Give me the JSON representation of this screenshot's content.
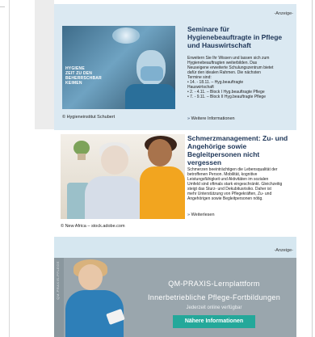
{
  "ad1": {
    "anzeige": "-Anzeige-",
    "image_overlay": [
      "HYGIENE",
      "ZEIT ZU DEN",
      "BEHERRSCHBAR",
      "KEIMEN"
    ],
    "credit": "© Hygieneinstitut Schubert",
    "title": "Seminare für Hygienebeauftragte in Pflege und Hauswirtschaft",
    "text_lines": [
      "Erweitern Sie Ihr Wissen und lassen sich zum",
      "Hygienebeauftragten weiterbilden. Das",
      "Neuseigene erweiterte Schulungszentrum bietet",
      "dafür den idealen Rahmen. Die nächsten",
      "Termine sind:",
      "• 14. - 18.11. – Hyg.beauftragte",
      "Hauswirtschaft",
      "• 2. - 4.11. – Block I Hyg.beauftragte Pflege",
      "• 7. - 9.11. – Block II Hyg.beauftragte Pflege"
    ],
    "link": "Weitere Informationen"
  },
  "art2": {
    "credit": "© New Africa – stock.adobe.com",
    "title": "Schmerzmanagement: Zu- und Angehörige sowie Begleitpersonen nicht vergessen",
    "text_lines": [
      "Schmerzen beeinträchtigen die Lebensqualität der",
      "betroffenen Person. Mobilität, kognitive",
      "Leistungsfähigkeit und Aktivitäten im sozialen",
      "Umfeld sind oftmals stark eingeschränkt. Gleichzeitig",
      "steigt das Sturz- und Dekubitusrisiko. Daher ist",
      "mehr Unterstützung von Pflegekräften, Zu- und",
      "Angehörigen sowie Begleitpersonen nötig."
    ],
    "link": "Weiterlesen"
  },
  "ad3": {
    "anzeige": "-Anzeige-",
    "stripe_text": "QM-PRAXIS-PFLEGE",
    "headline1": "QM-PRAXIS-Lernplattform",
    "headline2": "Innerbetriebliche Pflege-Fortbildungen",
    "sub": "Jederzeit online verfügbar",
    "cta": "Nähere Informationen"
  }
}
